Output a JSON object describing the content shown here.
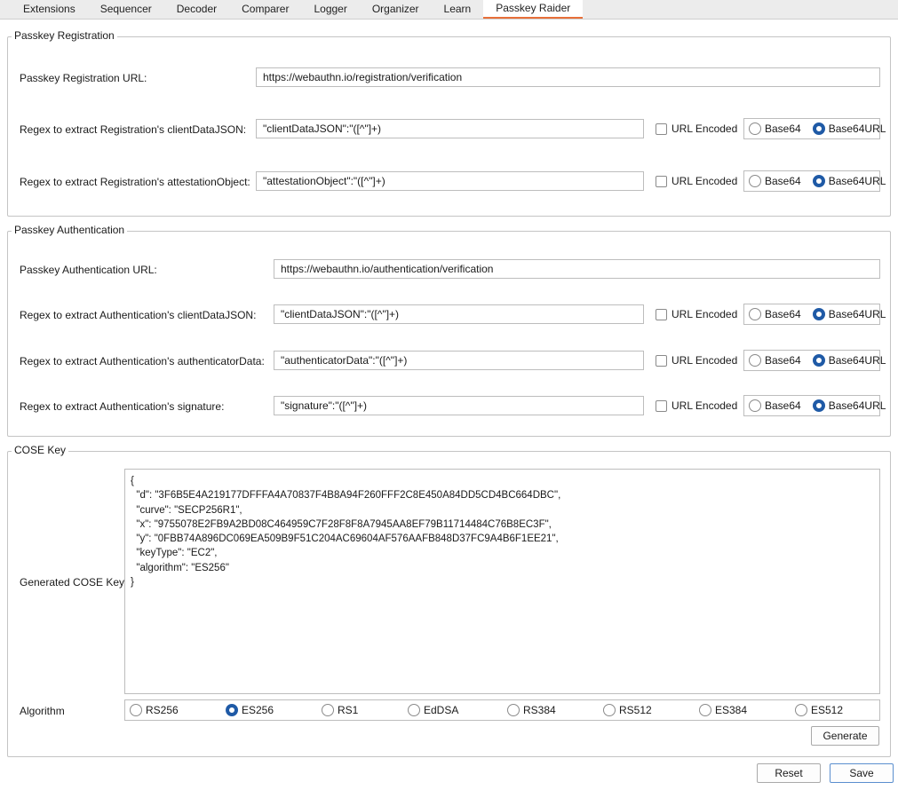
{
  "tabs": [
    {
      "label": "Extensions"
    },
    {
      "label": "Sequencer"
    },
    {
      "label": "Decoder"
    },
    {
      "label": "Comparer"
    },
    {
      "label": "Logger"
    },
    {
      "label": "Organizer"
    },
    {
      "label": "Learn"
    },
    {
      "label": "Passkey Raider",
      "active": true
    }
  ],
  "registration": {
    "title": "Passkey Registration",
    "url_label": "Passkey Registration URL:",
    "url_value": "https://webauthn.io/registration/verification",
    "rows": [
      {
        "label": "Regex to extract Registration's clientDataJSON:",
        "value": "\"clientDataJSON\":\"([^\"]+)",
        "url_encoded_label": "URL Encoded",
        "url_encoded": false,
        "base64_label": "Base64",
        "base64url_label": "Base64URL",
        "selected": "Base64URL"
      },
      {
        "label": "Regex to extract Registration's attestationObject:",
        "value": "\"attestationObject\":\"([^\"]+)",
        "url_encoded_label": "URL Encoded",
        "url_encoded": false,
        "base64_label": "Base64",
        "base64url_label": "Base64URL",
        "selected": "Base64URL"
      }
    ]
  },
  "authentication": {
    "title": "Passkey Authentication",
    "url_label": "Passkey Authentication URL:",
    "url_value": "https://webauthn.io/authentication/verification",
    "rows": [
      {
        "label": "Regex to extract Authentication's clientDataJSON:",
        "value": "\"clientDataJSON\":\"([^\"]+)",
        "url_encoded_label": "URL Encoded",
        "url_encoded": false,
        "base64_label": "Base64",
        "base64url_label": "Base64URL",
        "selected": "Base64URL"
      },
      {
        "label": "Regex to extract Authentication's authenticatorData:",
        "value": "\"authenticatorData\":\"([^\"]+)",
        "url_encoded_label": "URL Encoded",
        "url_encoded": false,
        "base64_label": "Base64",
        "base64url_label": "Base64URL",
        "selected": "Base64URL"
      },
      {
        "label": "Regex to extract Authentication's signature:",
        "value": "\"signature\":\"([^\"]+)",
        "url_encoded_label": "URL Encoded",
        "url_encoded": false,
        "base64_label": "Base64",
        "base64url_label": "Base64URL",
        "selected": "Base64URL"
      }
    ]
  },
  "cose": {
    "title": "COSE Key",
    "generated_label": "Generated COSE Key",
    "generated_value": "{\n  \"d\": \"3F6B5E4A219177DFFFA4A70837F4B8A94F260FFF2C8E450A84DD5CD4BC664DBC\",\n  \"curve\": \"SECP256R1\",\n  \"x\": \"9755078E2FB9A2BD08C464959C7F28F8F8A7945AA8EF79B11714484C76B8EC3F\",\n  \"y\": \"0FBB74A896DC069EA509B9F51C204AC69604AF576AAFB848D37FC9A4B6F1EE21\",\n  \"keyType\": \"EC2\",\n  \"algorithm\": \"ES256\"\n}",
    "algorithm_label": "Algorithm",
    "algorithms": [
      "RS256",
      "ES256",
      "RS1",
      "EdDSA",
      "RS384",
      "RS512",
      "ES384",
      "ES512"
    ],
    "selected_algorithm": "ES256",
    "generate_label": "Generate"
  },
  "footer": {
    "reset_label": "Reset",
    "save_label": "Save"
  },
  "colors": {
    "accent": "#e8703a",
    "radio_selected": "#1f5aa6"
  }
}
